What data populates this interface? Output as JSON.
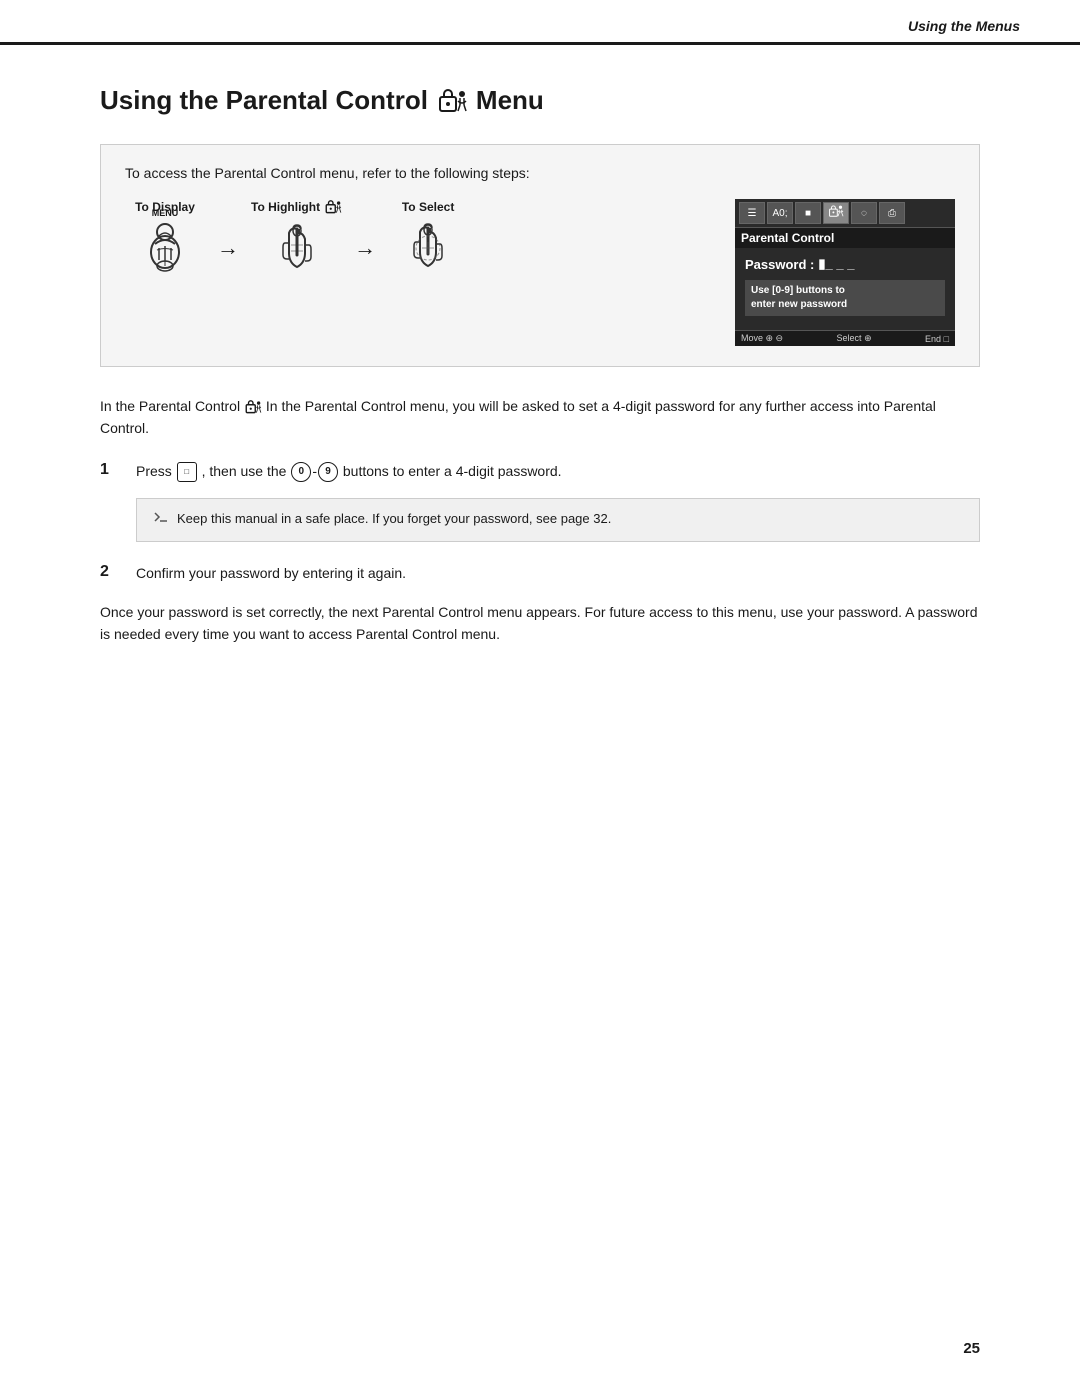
{
  "header": {
    "title": "Using the Menus"
  },
  "page_title": "Using the Parental Control",
  "page_title_suffix": "Menu",
  "instruction_box": {
    "intro": "To access the Parental Control menu, refer to the following steps:",
    "step1_label": "To Display",
    "step2_label": "To Highlight",
    "step3_label": "To Select",
    "menu_label": "MENU"
  },
  "tv_screen": {
    "title": "Parental Control",
    "password_label": "Password :",
    "hint_line1": "Use [0-9] buttons to",
    "hint_line2": "enter new password",
    "status_move": "Move",
    "status_select": "Select",
    "status_end": "End"
  },
  "body_text": "In the Parental Control menu, you will be asked to set a 4-digit password for any further access into Parental Control.",
  "step1": {
    "number": "1",
    "text_before": "Press",
    "text_middle": ", then use the",
    "text_range": "0",
    "text_dash": "-",
    "text_range2": "9",
    "text_after": "buttons to enter a 4-digit password."
  },
  "note": {
    "text": "Keep this manual in a safe place. If you forget your password, see page 32."
  },
  "step2": {
    "number": "2",
    "text": "Confirm your password by entering it again."
  },
  "conclusion": "Once your password is set correctly, the next Parental Control menu appears. For future access to this menu, use your password. A password is needed every time you want to access Parental Control menu.",
  "page_number": "25"
}
